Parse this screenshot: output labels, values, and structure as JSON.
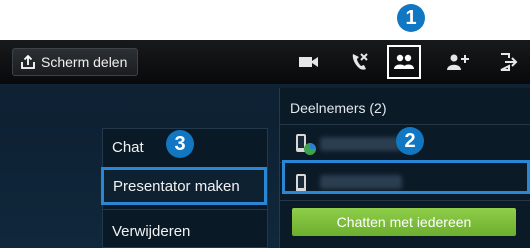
{
  "toolbar": {
    "share_label": "Scherm delen",
    "icons": [
      "share-upload-icon",
      "video-camera-icon",
      "end-call-icon",
      "participants-icon",
      "add-participant-icon",
      "exit-icon"
    ]
  },
  "participants": {
    "header": "Deelnemers (2)"
  },
  "context_menu": {
    "items": [
      "Chat",
      "Presentator maken",
      "Verwijderen"
    ]
  },
  "chat_all_button": "Chatten met iedereen",
  "callouts": [
    "1",
    "2",
    "3"
  ],
  "colors": {
    "highlight": "#2b86d6",
    "badge": "#1177c2",
    "chat_button": "#7bbf3a"
  }
}
